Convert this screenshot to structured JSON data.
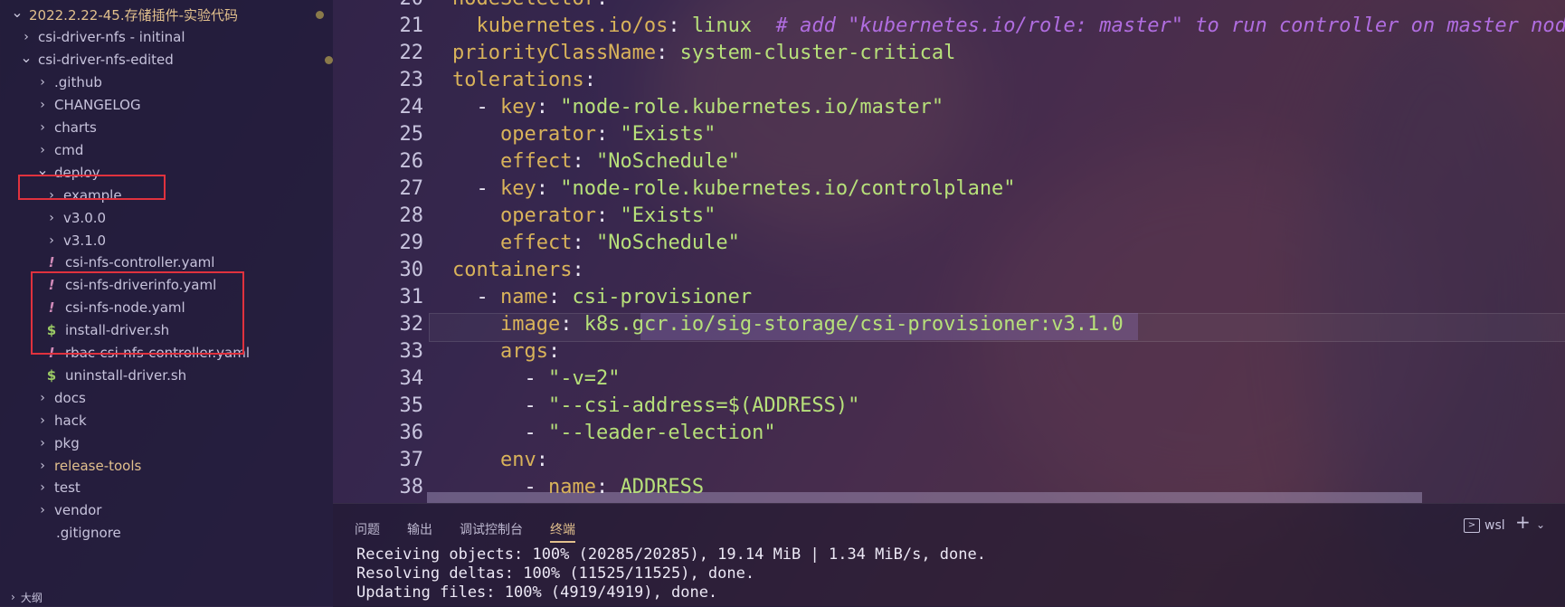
{
  "explorer": {
    "items": [
      {
        "label": "2022.2.22-45.存储插件-实验代码",
        "chevron": "v",
        "modified": true,
        "color": "yellow"
      },
      {
        "label": "csi-driver-nfs - initinal",
        "chevron": ">"
      },
      {
        "label": "csi-driver-nfs-edited",
        "chevron": "v",
        "modified": true
      },
      {
        "label": ".github",
        "chevron": ">"
      },
      {
        "label": "CHANGELOG",
        "chevron": ">"
      },
      {
        "label": "charts",
        "chevron": ">"
      },
      {
        "label": "cmd",
        "chevron": ">"
      },
      {
        "label": "deploy",
        "chevron": "v"
      },
      {
        "label": "example",
        "chevron": ">"
      },
      {
        "label": "v3.0.0",
        "chevron": ">"
      },
      {
        "label": "v3.1.0",
        "chevron": ">"
      },
      {
        "label": "csi-nfs-controller.yaml",
        "icon": "!"
      },
      {
        "label": "csi-nfs-driverinfo.yaml",
        "icon": "!"
      },
      {
        "label": "csi-nfs-node.yaml",
        "icon": "!"
      },
      {
        "label": "install-driver.sh",
        "icon": "$"
      },
      {
        "label": "rbac-csi-nfs-controller.yaml",
        "icon": "!"
      },
      {
        "label": "uninstall-driver.sh",
        "icon": "$"
      },
      {
        "label": "docs",
        "chevron": ">"
      },
      {
        "label": "hack",
        "chevron": ">"
      },
      {
        "label": "pkg",
        "chevron": ">"
      },
      {
        "label": "release-tools",
        "chevron": ">",
        "modified": true,
        "color": "yellow"
      },
      {
        "label": "test",
        "chevron": ">"
      },
      {
        "label": "vendor",
        "chevron": ">"
      },
      {
        "label": ".gitignore",
        "icon": ""
      }
    ],
    "outline_label": "大纲"
  },
  "editor": {
    "lines": [
      {
        "n": "20",
        "indent": "",
        "key": "nodeSelector",
        "sep": ":",
        "val": ""
      },
      {
        "n": "21",
        "indent": "  ",
        "key": "kubernetes.io/os",
        "sep": ": ",
        "val": "linux",
        "comment": "  # add \"kubernetes.io/role: master\" to run controller on master node"
      },
      {
        "n": "22",
        "indent": "",
        "key": "priorityClassName",
        "sep": ": ",
        "val": "system-cluster-critical"
      },
      {
        "n": "23",
        "indent": "",
        "key": "tolerations",
        "sep": ":",
        "val": ""
      },
      {
        "n": "24",
        "indent": "  - ",
        "key": "key",
        "sep": ": ",
        "val": "\"node-role.kubernetes.io/master\""
      },
      {
        "n": "25",
        "indent": "    ",
        "key": "operator",
        "sep": ": ",
        "val": "\"Exists\""
      },
      {
        "n": "26",
        "indent": "    ",
        "key": "effect",
        "sep": ": ",
        "val": "\"NoSchedule\""
      },
      {
        "n": "27",
        "indent": "  - ",
        "key": "key",
        "sep": ": ",
        "val": "\"node-role.kubernetes.io/controlplane\""
      },
      {
        "n": "28",
        "indent": "    ",
        "key": "operator",
        "sep": ": ",
        "val": "\"Exists\""
      },
      {
        "n": "29",
        "indent": "    ",
        "key": "effect",
        "sep": ": ",
        "val": "\"NoSchedule\""
      },
      {
        "n": "30",
        "indent": "",
        "key": "containers",
        "sep": ":",
        "val": ""
      },
      {
        "n": "31",
        "indent": "  - ",
        "key": "name",
        "sep": ": ",
        "val": "csi-provisioner"
      },
      {
        "n": "32",
        "indent": "    ",
        "key": "image",
        "sep": ": ",
        "val": "k8s.gcr.io/sig-storage/csi-provisioner:v3.1.0"
      },
      {
        "n": "33",
        "indent": "    ",
        "key": "args",
        "sep": ":",
        "val": ""
      },
      {
        "n": "34",
        "indent": "      - ",
        "key": "",
        "sep": "",
        "val": "\"-v=2\""
      },
      {
        "n": "35",
        "indent": "      - ",
        "key": "",
        "sep": "",
        "val": "\"--csi-address=$(ADDRESS)\""
      },
      {
        "n": "36",
        "indent": "      - ",
        "key": "",
        "sep": "",
        "val": "\"--leader-election\""
      },
      {
        "n": "37",
        "indent": "    ",
        "key": "env",
        "sep": ":",
        "val": ""
      },
      {
        "n": "38",
        "indent": "      - ",
        "key": "name",
        "sep": ": ",
        "val": "ADDRESS"
      }
    ]
  },
  "panel": {
    "tabs": [
      "问题",
      "输出",
      "调试控制台",
      "终端"
    ],
    "active_tab": "终端",
    "shell": "wsl",
    "terminal_lines": [
      "Receiving objects: 100% (20285/20285), 19.14 MiB | 1.34 MiB/s, done.",
      "Resolving deltas: 100% (11525/11525), done.",
      "Updating files: 100% (4919/4919), done."
    ]
  }
}
